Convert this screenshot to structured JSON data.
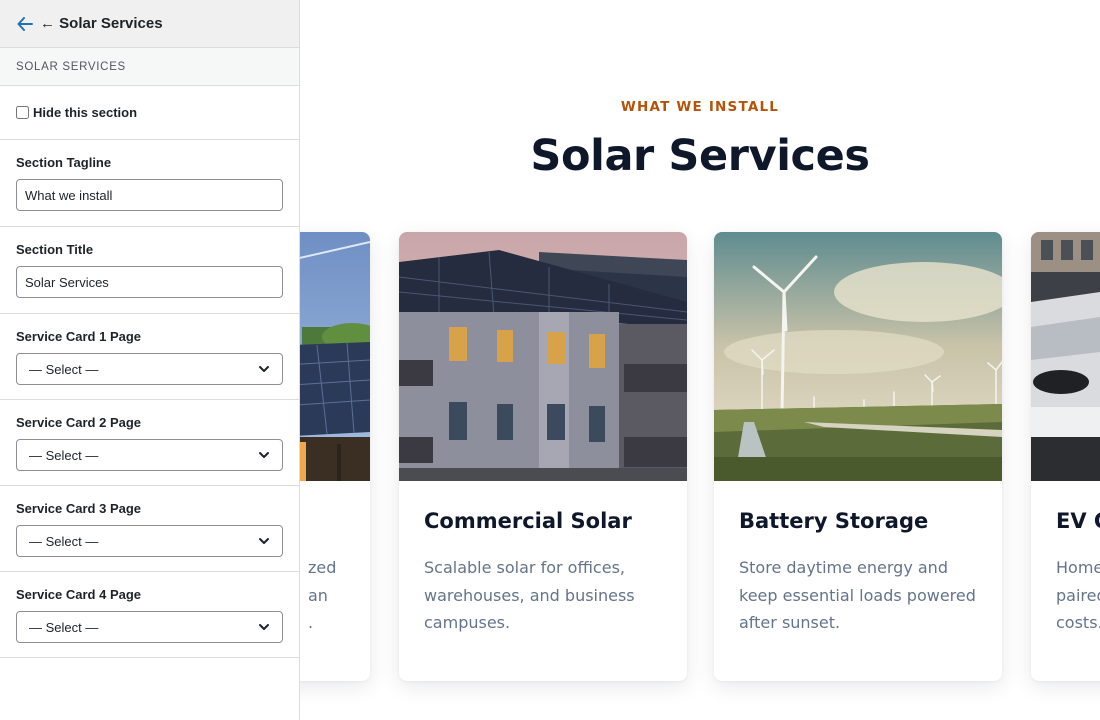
{
  "sidebar": {
    "header_title": "← Solar Services",
    "back_icon": "arrow-left-icon",
    "section_label": "SOLAR SERVICES",
    "hide_label": "Hide this section",
    "hide_checked": false,
    "tagline_label": "Section Tagline",
    "tagline_value": "What we install",
    "title_label": "Section Title",
    "title_value": "Solar Services",
    "card_fields": [
      {
        "label": "Service Card 1 Page",
        "value": "— Select —"
      },
      {
        "label": "Service Card 2 Page",
        "value": "— Select —"
      },
      {
        "label": "Service Card 3 Page",
        "value": "— Select —"
      },
      {
        "label": "Service Card 4 Page",
        "value": "— Select —"
      }
    ],
    "colors": {
      "back_icon": "#2271b1",
      "border": "#dcdcde",
      "header_bg": "#f0f0f1"
    }
  },
  "preview": {
    "tagline": "WHAT WE INSTALL",
    "title": "Solar Services",
    "cards": [
      {
        "title": "",
        "desc_lines": [
          "zed",
          "an",
          "."
        ]
      },
      {
        "title": "Commercial Solar",
        "desc": "Scalable solar for offices, warehouses, and business campuses."
      },
      {
        "title": "Battery Storage",
        "desc": "Store daytime energy and keep essential loads powered after sunset."
      },
      {
        "title": "EV C",
        "desc_lines": [
          "Home",
          "paired",
          "costs."
        ]
      }
    ],
    "colors": {
      "tagline": "#b45309",
      "title": "#0f172a",
      "desc": "#64748b"
    }
  }
}
